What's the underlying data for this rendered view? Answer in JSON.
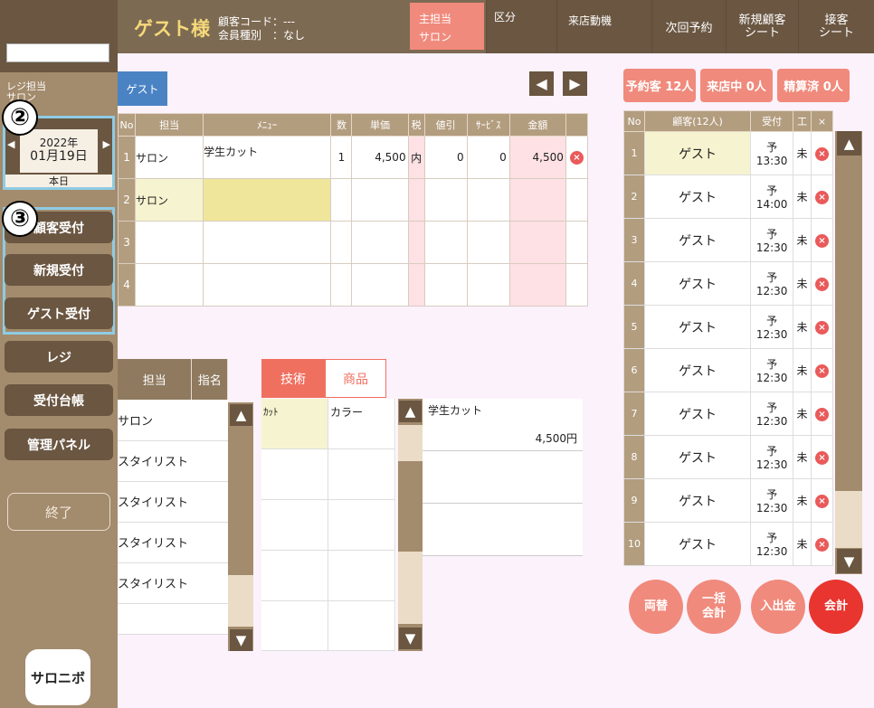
{
  "sidebar": {
    "reji_label": "レジ担当\nサロン",
    "date": {
      "year": "2022年",
      "month_day": "01月19日",
      "today": "本日"
    },
    "markers": {
      "date": "②",
      "accept": "③"
    },
    "accept_buttons": [
      "顧客受付",
      "新規受付",
      "ゲスト受付"
    ],
    "other_buttons": [
      "レジ",
      "受付台帳",
      "管理パネル"
    ],
    "end_button": "終了",
    "logo_text": "サロニボ"
  },
  "header": {
    "guest_name": "ゲスト様",
    "customer_info": "顧客コード：---\n会員種別　：なし",
    "main_staff_label": "主担当",
    "main_staff_value": "サロン",
    "cells": [
      "区分",
      "来店動機",
      "次回予約",
      "新規顧客\nシート",
      "接客\nシート"
    ]
  },
  "order": {
    "guest_tab": "ゲスト",
    "columns": [
      "No",
      "担当",
      "ﾒﾆｭｰ",
      "数",
      "単価",
      "税",
      "値引",
      "ｻｰﾋﾞｽ",
      "金額",
      ""
    ],
    "rows": [
      {
        "no": "1",
        "staff": "サロン",
        "menu": "学生カット",
        "qty": "1",
        "price": "4,500",
        "tax": "内",
        "discount": "0",
        "service": "0",
        "amount": "4,500"
      },
      {
        "no": "2",
        "staff": "サロン",
        "menu": "",
        "qty": "",
        "price": "",
        "tax": "",
        "discount": "",
        "service": "",
        "amount": ""
      },
      {
        "no": "3",
        "staff": "",
        "menu": "",
        "qty": "",
        "price": "",
        "tax": "",
        "discount": "",
        "service": "",
        "amount": ""
      },
      {
        "no": "4",
        "staff": "",
        "menu": "",
        "qty": "",
        "price": "",
        "tax": "",
        "discount": "",
        "service": "",
        "amount": ""
      }
    ]
  },
  "staff_list": {
    "headers": [
      "担当",
      "指名"
    ],
    "rows": [
      "サロン",
      "スタイリスト",
      "スタイリスト",
      "スタイリスト",
      "スタイリスト",
      ""
    ]
  },
  "tabs": {
    "tech": "技術",
    "product": "商品"
  },
  "categories": [
    "ｶｯﾄ",
    "カラー"
  ],
  "menu_items": [
    {
      "name": "学生カット",
      "price": "4,500円"
    }
  ],
  "status": [
    "予約客 12人",
    "来店中 0人",
    "精算済 0人"
  ],
  "reservations": {
    "headers": [
      "No",
      "顧客(12人)",
      "受付",
      "工",
      "×"
    ],
    "rows": [
      {
        "no": "1",
        "name": "ゲスト",
        "time": "予13:30",
        "st": "未"
      },
      {
        "no": "2",
        "name": "ゲスト",
        "time": "予14:00",
        "st": "未"
      },
      {
        "no": "3",
        "name": "ゲスト",
        "time": "予12:30",
        "st": "未"
      },
      {
        "no": "4",
        "name": "ゲスト",
        "time": "予12:30",
        "st": "未"
      },
      {
        "no": "5",
        "name": "ゲスト",
        "time": "予12:30",
        "st": "未"
      },
      {
        "no": "6",
        "name": "ゲスト",
        "time": "予12:30",
        "st": "未"
      },
      {
        "no": "7",
        "name": "ゲスト",
        "time": "予12:30",
        "st": "未"
      },
      {
        "no": "8",
        "name": "ゲスト",
        "time": "予12:30",
        "st": "未"
      },
      {
        "no": "9",
        "name": "ゲスト",
        "time": "予12:30",
        "st": "未"
      },
      {
        "no": "10",
        "name": "ゲスト",
        "time": "予12:30",
        "st": "未"
      }
    ]
  },
  "actions": [
    "両替",
    "一括\n会計",
    "入出金",
    "会計"
  ],
  "colors": {
    "accent": "#f08a7c",
    "checkout": "#e8352f",
    "brown": "#6a5641"
  }
}
